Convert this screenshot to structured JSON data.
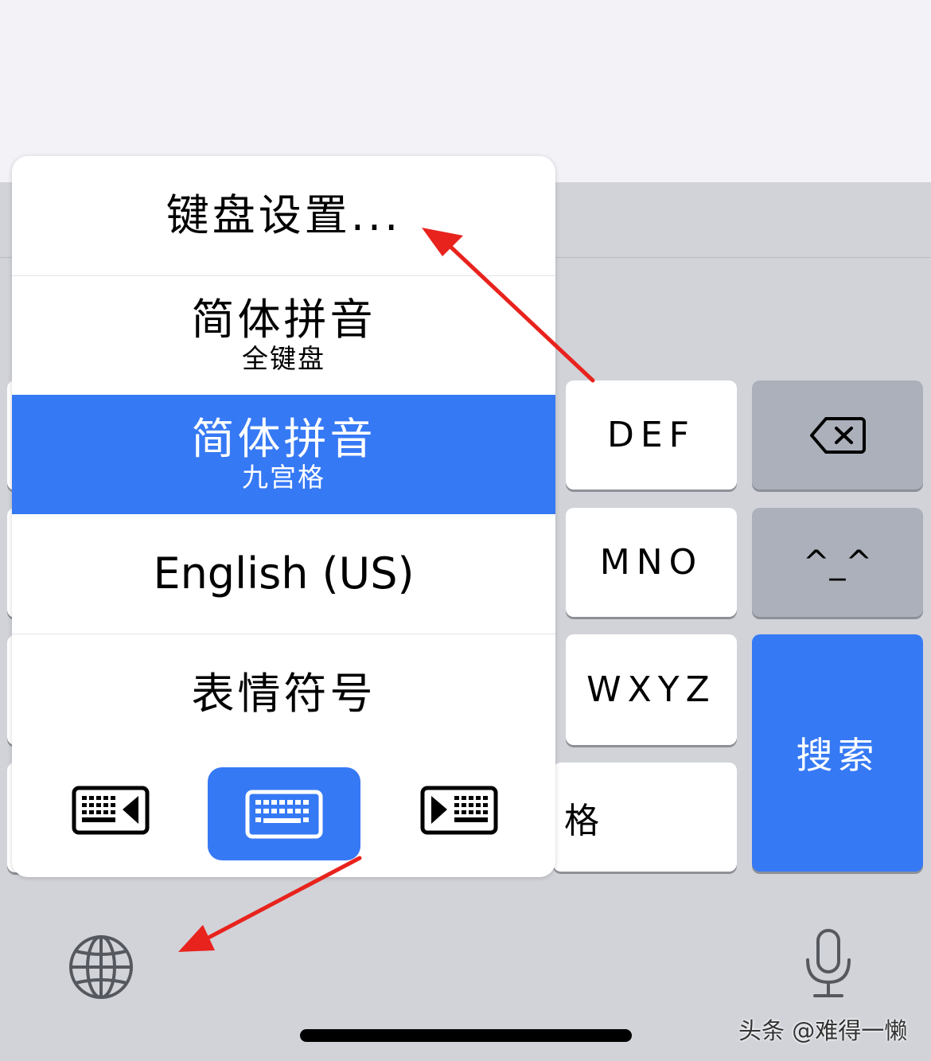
{
  "popup_menu": {
    "keyboard_settings": "键盘设置...",
    "items": [
      {
        "title": "简体拼音",
        "subtitle": "全键盘"
      },
      {
        "title": "简体拼音",
        "subtitle": "九宫格"
      },
      {
        "title": "English (US)"
      },
      {
        "title": "表情符号"
      }
    ],
    "selected_index": 1,
    "mode_icons": [
      "keyboard-left-icon",
      "keyboard-center-icon",
      "keyboard-right-icon"
    ]
  },
  "keyboard": {
    "keys": {
      "def": "DEF",
      "mno": "MNO",
      "wxyz": "WXYZ",
      "space_partial": "格",
      "search": "搜索",
      "emoticon": "^_^"
    },
    "bottom_icons": [
      "globe-icon",
      "microphone-icon"
    ]
  },
  "watermark": "头条 @难得一懒",
  "colors": {
    "accent": "#3679f5",
    "keyboard_bg": "#d1d3d9",
    "dark_key": "#abb0bb",
    "annotation_arrow": "#e8231d"
  }
}
